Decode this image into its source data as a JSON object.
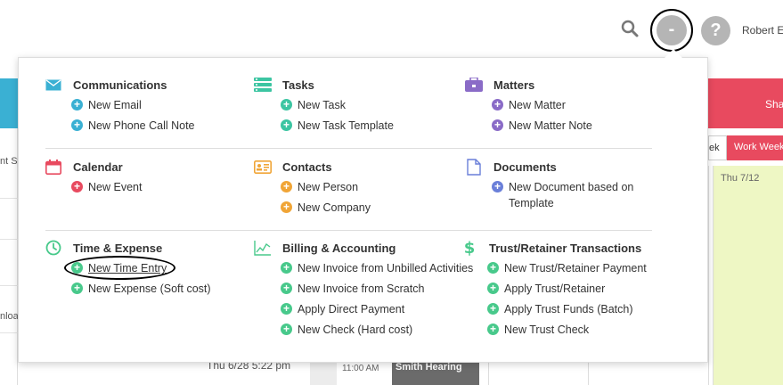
{
  "header": {
    "user_name": "Robert E",
    "plus_label": "-",
    "help_label": "?"
  },
  "background": {
    "left_rows": [
      "nt Sy",
      "nloa"
    ],
    "last_activity": "Thu 6/28 5:22 pm",
    "time_slot": "11:00 AM",
    "event_title": "Smith Hearing",
    "share_label": "Sha",
    "tab_week": "ek",
    "tab_work_week": "Work Week",
    "day_header": "Thu 7/12"
  },
  "menu": {
    "communications": {
      "title": "Communications",
      "items": [
        "New Email",
        "New Phone Call Note"
      ]
    },
    "tasks": {
      "title": "Tasks",
      "items": [
        "New Task",
        "New Task Template"
      ]
    },
    "matters": {
      "title": "Matters",
      "items": [
        "New Matter",
        "New Matter Note"
      ]
    },
    "calendar": {
      "title": "Calendar",
      "items": [
        "New Event"
      ]
    },
    "contacts": {
      "title": "Contacts",
      "items": [
        "New Person",
        "New Company"
      ]
    },
    "documents": {
      "title": "Documents",
      "items": [
        "New Document based on Template"
      ]
    },
    "time_expense": {
      "title": "Time & Expense",
      "items": [
        "New Time Entry",
        "New Expense (Soft cost)"
      ]
    },
    "billing": {
      "title": "Billing & Accounting",
      "items": [
        "New Invoice from Unbilled Activities",
        "New Invoice from Scratch",
        "Apply Direct Payment",
        "New Check (Hard cost)"
      ]
    },
    "trust": {
      "title": "Trust/Retainer Transactions",
      "items": [
        "New Trust/Retainer Payment",
        "Apply Trust/Retainer",
        "Apply Trust Funds (Batch)",
        "New Trust Check"
      ]
    }
  },
  "colors": {
    "blue": "#3ab0d3",
    "teal": "#3cc5a2",
    "purple": "#8a6bc7",
    "red": "#e84a5f",
    "orange": "#f0a537",
    "green": "#48c98b"
  }
}
